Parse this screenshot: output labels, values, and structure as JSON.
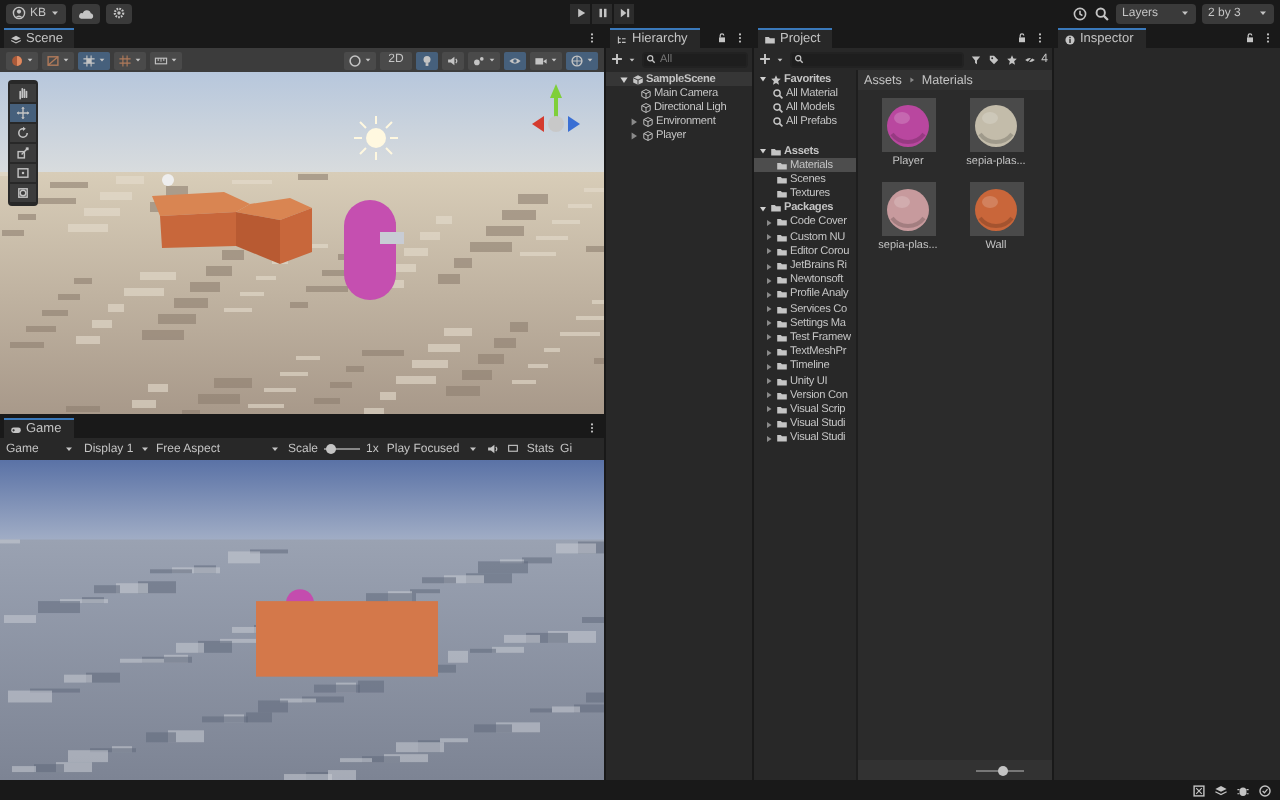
{
  "toolbar": {
    "account": "KB",
    "layers": "Layers",
    "layout": "2 by 3"
  },
  "scene": {
    "tab": "Scene",
    "buttons": [
      {
        "kind": "icon",
        "on": false,
        "dropdown": true
      },
      {
        "kind": "icon",
        "on": false,
        "dropdown": true
      },
      {
        "kind": "icon",
        "on": true,
        "dropdown": true
      },
      {
        "kind": "icon",
        "on": false,
        "dropdown": true
      },
      {
        "kind": "icon",
        "on": false,
        "dropdown": true
      },
      {
        "kind": "gap"
      },
      {
        "kind": "icon",
        "on": false,
        "dropdown": true
      },
      {
        "kind": "text",
        "label": "2D",
        "on": false
      },
      {
        "kind": "icon",
        "on": true,
        "dropdown": false
      },
      {
        "kind": "icon",
        "on": false,
        "dropdown": false
      },
      {
        "kind": "icon",
        "on": false,
        "dropdown": true
      },
      {
        "kind": "icon",
        "on": true,
        "dropdown": false
      },
      {
        "kind": "icon",
        "on": false,
        "dropdown": true
      },
      {
        "kind": "icon",
        "on": true,
        "dropdown": true
      }
    ],
    "tools": [
      {
        "selected": false
      },
      {
        "selected": true
      },
      {
        "selected": false
      },
      {
        "selected": false
      },
      {
        "selected": false
      },
      {
        "selected": false
      }
    ]
  },
  "game": {
    "tab": "Game",
    "mode": "Game",
    "display": "Display 1",
    "aspect": "Free Aspect",
    "scale_label": "Scale",
    "scale": {
      "level": 0.15
    },
    "scale_value": "1x",
    "play_mode": "Play Focused",
    "stats": "Stats",
    "gizmos": "Gi"
  },
  "hierarchy": {
    "title": "Hierarchy",
    "search_placeholder": "All",
    "items": [
      {
        "label": "SampleScene",
        "kind": "scene",
        "expandable": true,
        "expanded": true,
        "children": [
          {
            "label": "Main Camera",
            "kind": "object",
            "expandable": false,
            "expanded": false
          },
          {
            "label": "Directional Ligh",
            "kind": "object",
            "expandable": false,
            "expanded": false
          },
          {
            "label": "Environment",
            "kind": "object",
            "expandable": true,
            "expanded": false
          },
          {
            "label": "Player",
            "kind": "object",
            "expandable": true,
            "expanded": false
          }
        ]
      }
    ]
  },
  "project": {
    "title": "Project",
    "hidden_count": "4",
    "favorites": {
      "label": "Favorites",
      "items": [
        "All Material",
        "All Models",
        "All Prefabs"
      ]
    },
    "tree": [
      {
        "label": "Assets",
        "expanded": true,
        "selected": false,
        "children": [
          {
            "label": "Materials",
            "selected": true
          },
          {
            "label": "Scenes",
            "selected": false
          },
          {
            "label": "Textures",
            "selected": false
          }
        ]
      },
      {
        "label": "Packages",
        "expanded": true,
        "selected": false,
        "children": [
          {
            "label": "Code Cover",
            "selected": false
          },
          {
            "label": "Custom NU",
            "selected": false
          },
          {
            "label": "Editor Corou",
            "selected": false
          },
          {
            "label": "JetBrains Ri",
            "selected": false
          },
          {
            "label": "Newtonsoft",
            "selected": false
          },
          {
            "label": "Profile Analy",
            "selected": false
          },
          {
            "label": "Services Co",
            "selected": false
          },
          {
            "label": "Settings Ma",
            "selected": false
          },
          {
            "label": "Test Framew",
            "selected": false
          },
          {
            "label": "TextMeshPr",
            "selected": false
          },
          {
            "label": "Timeline",
            "selected": false
          },
          {
            "label": "Unity UI",
            "selected": false
          },
          {
            "label": "Version Con",
            "selected": false
          },
          {
            "label": "Visual Scrip",
            "selected": false
          },
          {
            "label": "Visual Studi",
            "selected": false
          },
          {
            "label": "Visual Studi",
            "selected": false
          }
        ]
      }
    ],
    "breadcrumb": [
      "Assets",
      "Materials"
    ],
    "assets": [
      {
        "label": "Player",
        "color": "#b9479f"
      },
      {
        "label": "sepia-plas...",
        "color": "#c3bcaa"
      },
      {
        "label": "sepia-plas...",
        "color": "#c79a9d"
      },
      {
        "label": "Wall",
        "color": "#c9663a"
      }
    ],
    "icon_size": {
      "level": 0.55
    }
  },
  "inspector": {
    "title": "Inspector"
  }
}
